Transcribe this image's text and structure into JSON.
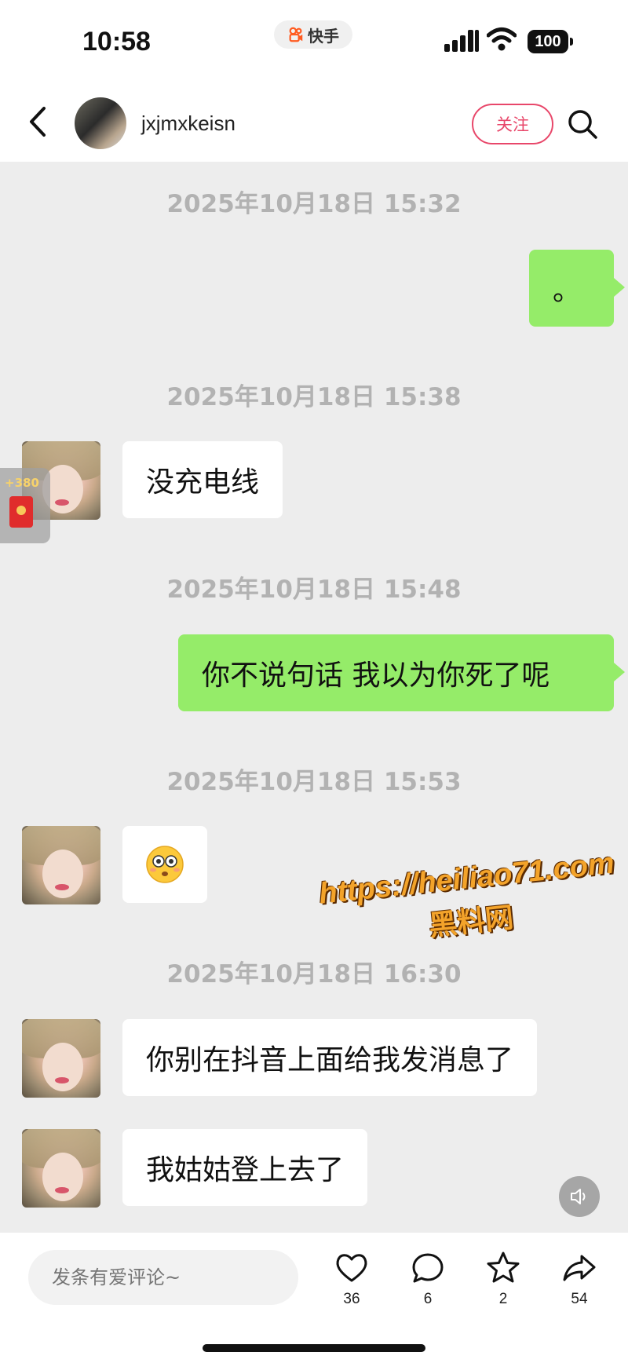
{
  "status_bar": {
    "time": "10:58",
    "app_name": "快手",
    "battery": "100",
    "icons": [
      "signal-icon",
      "wifi-icon",
      "battery-icon"
    ]
  },
  "header": {
    "username": "jxjmxkeisn",
    "follow_label": "关注",
    "icons": [
      "back-icon",
      "search-icon"
    ]
  },
  "chat": {
    "timestamps": [
      "2025年10月18日 15:32",
      "2025年10月18日 15:38",
      "2025年10月18日 15:48",
      "2025年10月18日 15:53",
      "2025年10月18日 16:30"
    ],
    "messages": [
      {
        "side": "right",
        "text": "。"
      },
      {
        "side": "left",
        "text": "没充电线"
      },
      {
        "side": "right",
        "text": "你不说句话 我以为你死了呢"
      },
      {
        "side": "left",
        "emoji": "flushed-face-icon"
      },
      {
        "side": "left",
        "text": "你别在抖音上面给我发消息了"
      },
      {
        "side": "left",
        "text": "我姑姑登上去了"
      }
    ]
  },
  "red_packet": {
    "count": "+380"
  },
  "watermark": {
    "url": "https://heiliao71.com",
    "name": "黑料网"
  },
  "bottom_bar": {
    "comment_placeholder": "发条有爱评论~",
    "actions": [
      {
        "icon": "heart-icon",
        "count": "36"
      },
      {
        "icon": "comment-icon",
        "count": "6"
      },
      {
        "icon": "star-icon",
        "count": "2"
      },
      {
        "icon": "share-icon",
        "count": "54"
      }
    ]
  }
}
